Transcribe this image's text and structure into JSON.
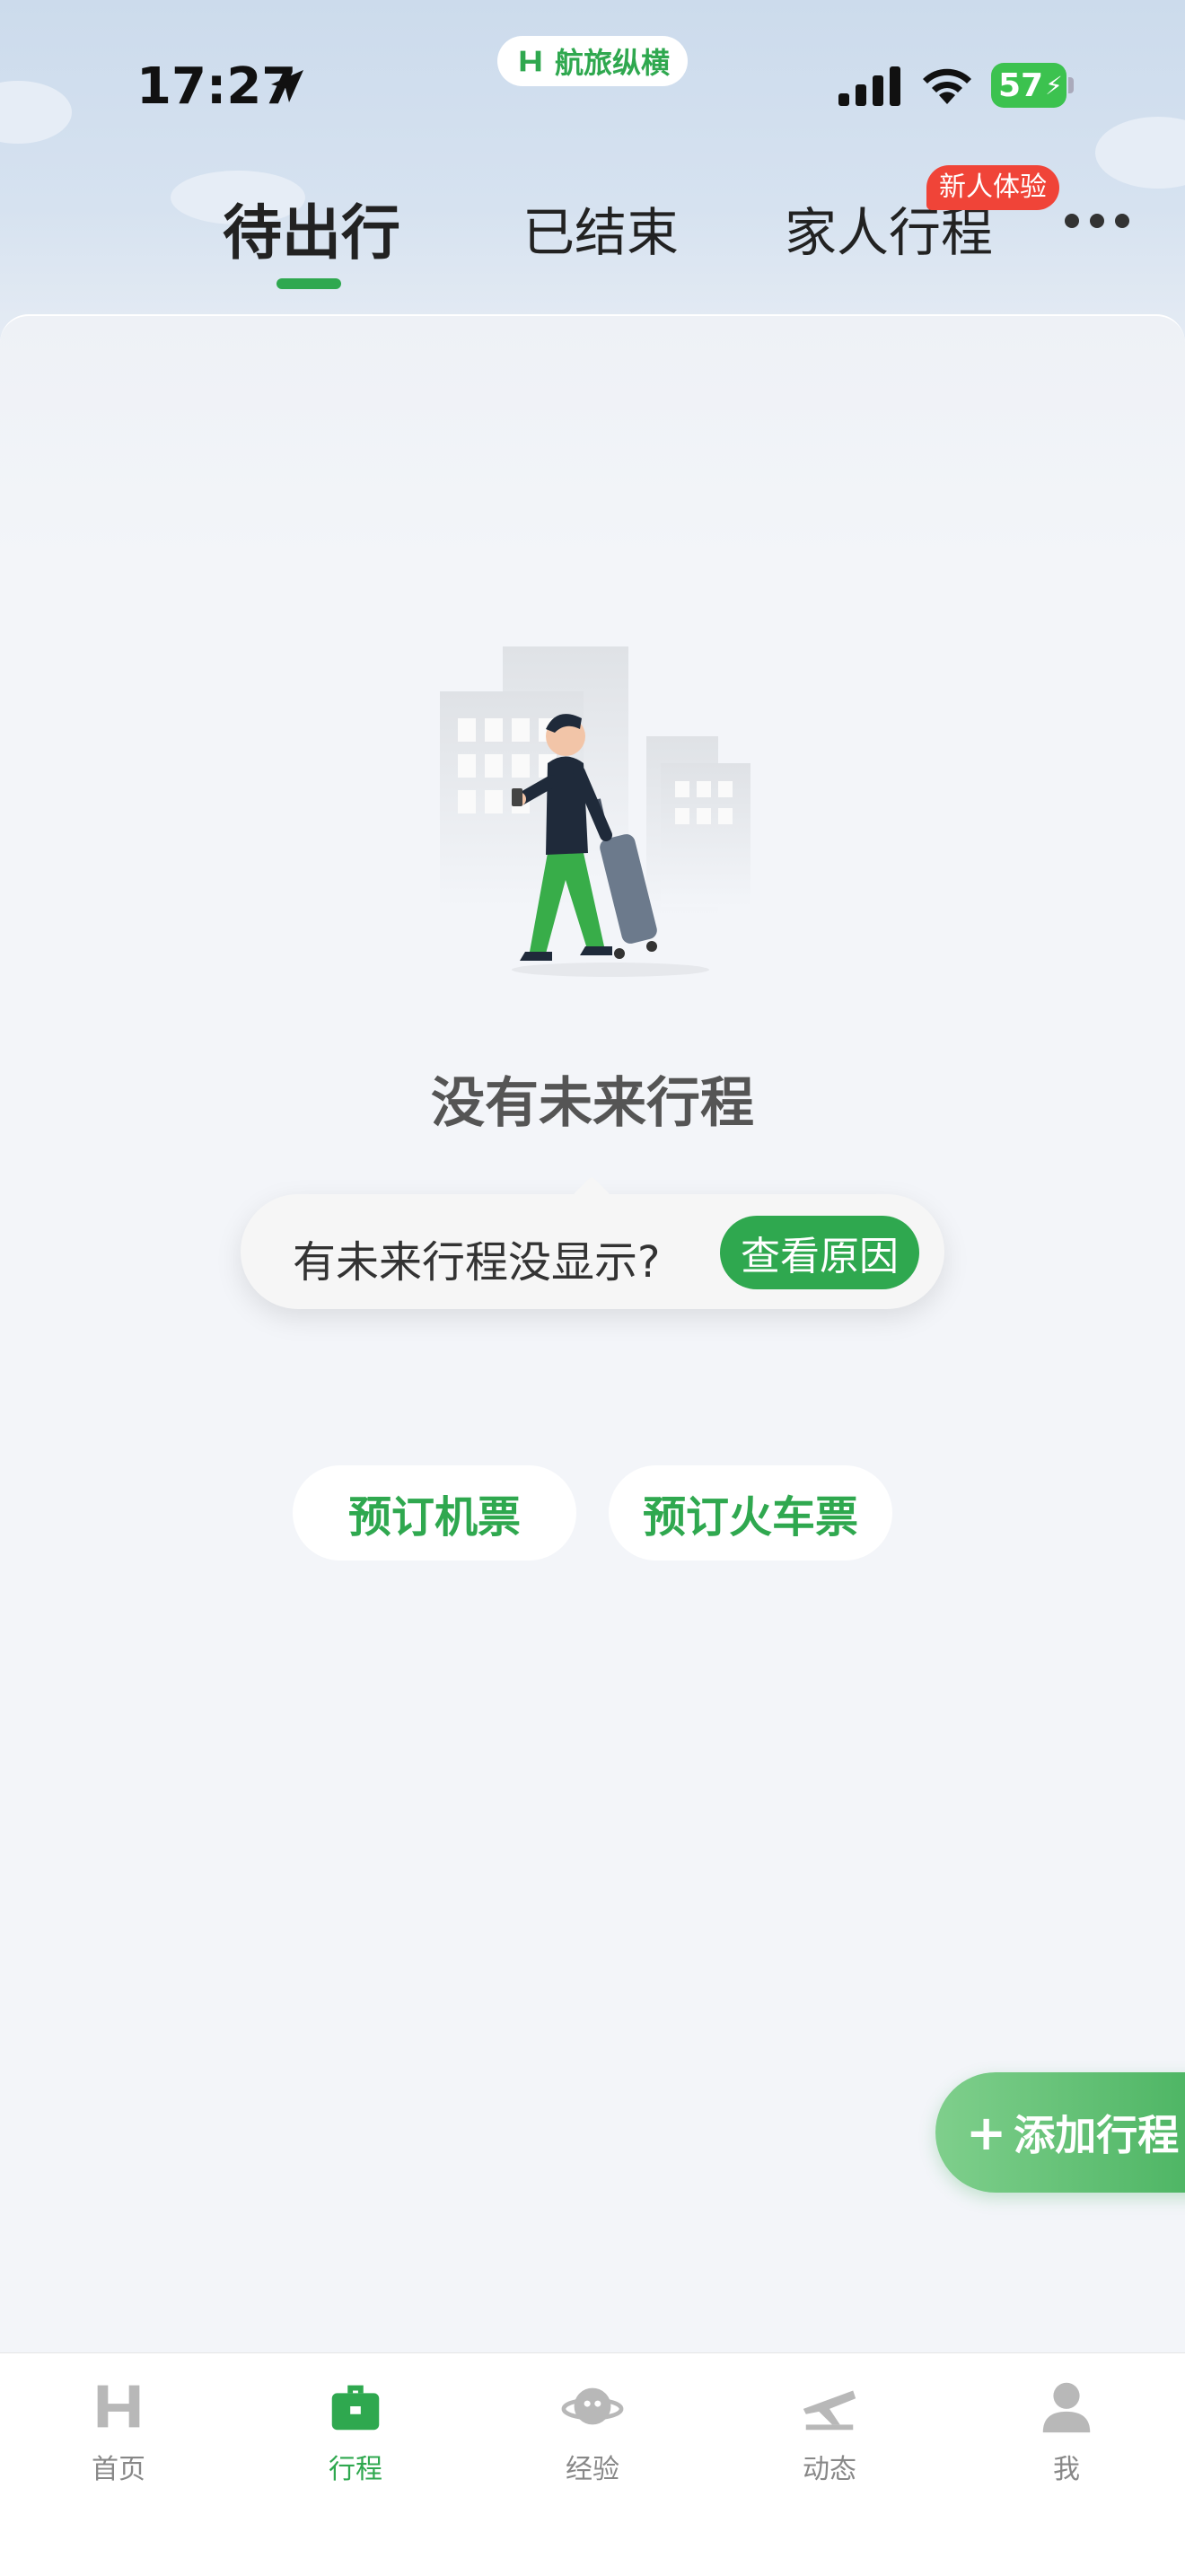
{
  "status_bar": {
    "time": "17:27",
    "battery": "57",
    "app_name": "航旅纵横"
  },
  "tabs": [
    {
      "label": "待出行",
      "active": true
    },
    {
      "label": "已结束",
      "active": false
    },
    {
      "label": "家人行程",
      "active": false
    }
  ],
  "badge": "新人体验",
  "empty_state": {
    "title": "没有未来行程",
    "hint": "有未来行程没显示?",
    "reason_button": "查看原因"
  },
  "actions": {
    "book_flight": "预订机票",
    "book_train": "预订火车票",
    "add_trip": "添加行程"
  },
  "nav": [
    {
      "label": "首页",
      "icon": "home-logo-icon",
      "active": false
    },
    {
      "label": "行程",
      "icon": "briefcase-icon",
      "active": true
    },
    {
      "label": "经验",
      "icon": "planet-icon",
      "active": false
    },
    {
      "label": "动态",
      "icon": "airplane-icon",
      "active": false
    },
    {
      "label": "我",
      "icon": "user-icon",
      "active": false
    }
  ],
  "colors": {
    "accent": "#2fa84f",
    "badge": "#f04438",
    "battery": "#3cc24f"
  }
}
